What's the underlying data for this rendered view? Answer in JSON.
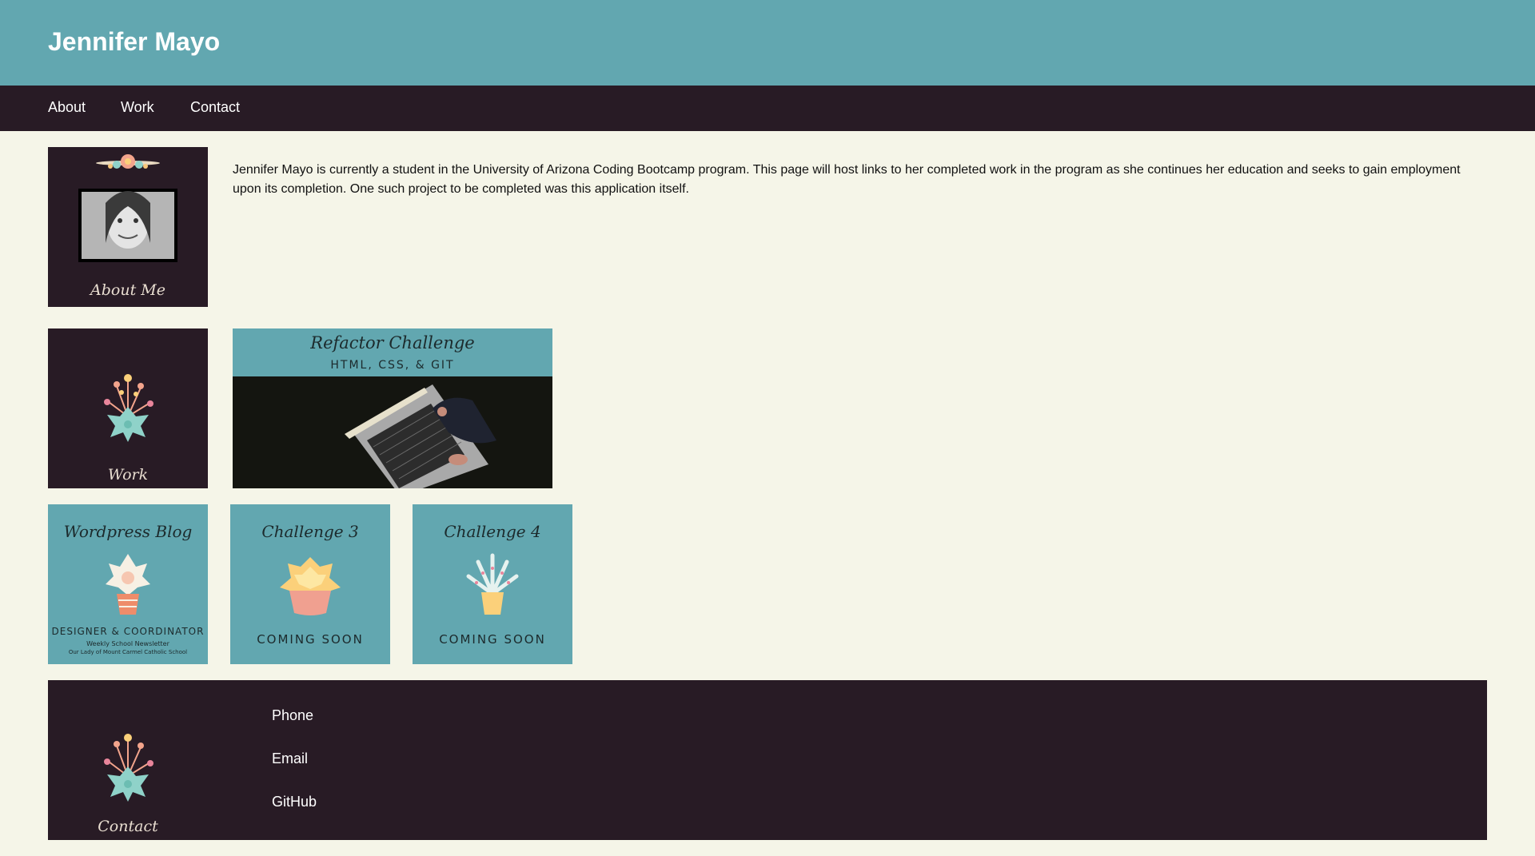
{
  "header": {
    "title": "Jennifer Mayo"
  },
  "nav": {
    "items": [
      "About",
      "Work",
      "Contact"
    ]
  },
  "about": {
    "tile_caption": "About Me",
    "text": "Jennifer Mayo is currently a student in the University of Arizona Coding Bootcamp program. This page will host links to her completed work in the program as she continues her education and seeks to gain employment upon its completion. One such project to be completed was this application itself."
  },
  "work": {
    "tile_caption": "Work",
    "featured": {
      "title": "Refactor Challenge",
      "subtitle": "HTML, CSS, & GIT"
    },
    "projects": [
      {
        "title": "Wordpress Blog",
        "line1": "DESIGNER & COORDINATOR",
        "line2": "Weekly School Newsletter",
        "line3": "Our Lady of Mount Carmel Catholic School"
      },
      {
        "title": "Challenge 3",
        "status": "COMING SOON"
      },
      {
        "title": "Challenge 4",
        "status": "COMING SOON"
      }
    ]
  },
  "footer": {
    "tile_caption": "Contact",
    "links": [
      "Phone",
      "Email",
      "GitHub"
    ]
  },
  "colors": {
    "header_bg": "#62a7b0",
    "nav_bg": "#281b25",
    "page_bg": "#f5f5e8",
    "tile_dark": "#281b25",
    "tile_teal": "#62a7b0"
  },
  "icons": [
    "flower-wreath-icon",
    "succulent-bouquet-icon",
    "laptop-photo",
    "potted-succulent-icon",
    "aloe-plant-icon"
  ]
}
